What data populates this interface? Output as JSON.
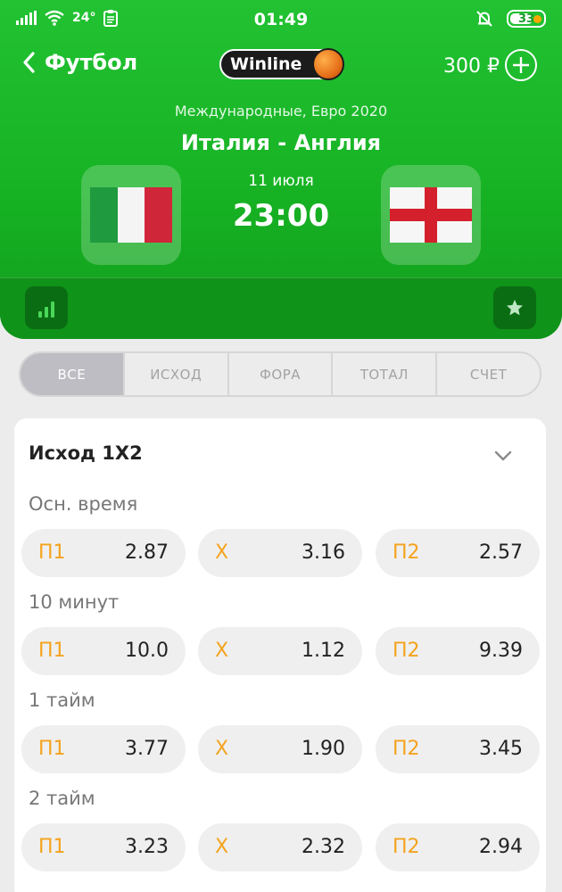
{
  "status": {
    "time": "01:49",
    "temperature": "24°",
    "battery": "33"
  },
  "nav": {
    "back_label": "Футбол",
    "brand": "Winline",
    "balance": "300 ₽"
  },
  "match": {
    "league": "Международные, Евро 2020",
    "teams": "Италия - Англия",
    "date": "11 июля",
    "time": "23:00",
    "home_flag": "italy-flag",
    "away_flag": "england-flag"
  },
  "tabs": [
    {
      "label": "ВСЕ",
      "active": true
    },
    {
      "label": "ИСХОД",
      "active": false
    },
    {
      "label": "ФОРА",
      "active": false
    },
    {
      "label": "ТОТАЛ",
      "active": false
    },
    {
      "label": "СЧЕТ",
      "active": false
    }
  ],
  "market": {
    "title": "Исход 1X2",
    "sections": [
      {
        "label": "Осн. время",
        "odds": [
          {
            "key": "П1",
            "value": "2.87"
          },
          {
            "key": "X",
            "value": "3.16"
          },
          {
            "key": "П2",
            "value": "2.57"
          }
        ]
      },
      {
        "label": "10 минут",
        "odds": [
          {
            "key": "П1",
            "value": "10.0"
          },
          {
            "key": "X",
            "value": "1.12"
          },
          {
            "key": "П2",
            "value": "9.39"
          }
        ]
      },
      {
        "label": "1 тайм",
        "odds": [
          {
            "key": "П1",
            "value": "3.77"
          },
          {
            "key": "X",
            "value": "1.90"
          },
          {
            "key": "П2",
            "value": "3.45"
          }
        ]
      },
      {
        "label": "2 тайм",
        "odds": [
          {
            "key": "П1",
            "value": "3.23"
          },
          {
            "key": "X",
            "value": "2.32"
          },
          {
            "key": "П2",
            "value": "2.94"
          }
        ]
      }
    ]
  },
  "colors": {
    "brand_green": "#17b324",
    "odds_key": "#f4a31d",
    "tab_active": "#bdbdc3"
  }
}
